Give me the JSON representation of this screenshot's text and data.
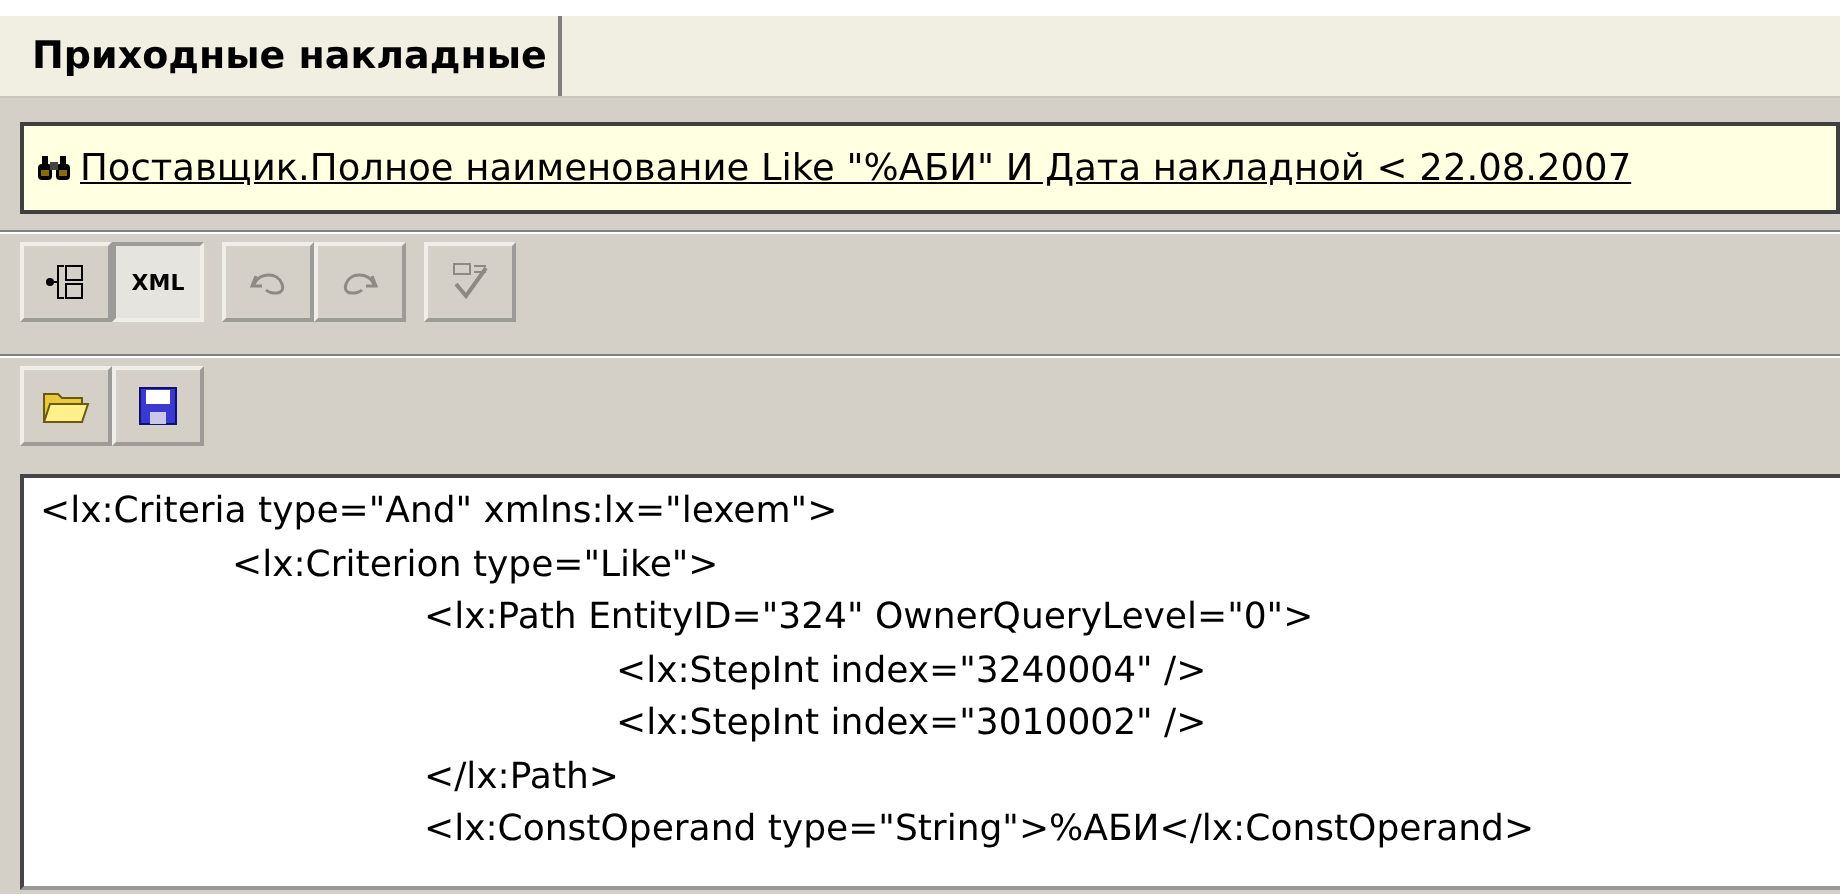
{
  "tabs": [
    {
      "label": "Приходные накладные",
      "selected": true
    }
  ],
  "filter": {
    "text": "Поставщик.Полное наименование Like \"%АБИ\" И  Дата накладной < 22.08.2007"
  },
  "toolbar": [
    {
      "kind": "tree",
      "selected": false,
      "disabled": false
    },
    {
      "kind": "xml",
      "label": "XML",
      "selected": true,
      "disabled": false
    },
    {
      "kind": "undo",
      "selected": false,
      "disabled": true
    },
    {
      "kind": "redo",
      "selected": false,
      "disabled": true
    },
    {
      "kind": "check",
      "selected": false,
      "disabled": true
    }
  ],
  "file_toolbar": [
    {
      "kind": "open"
    },
    {
      "kind": "save"
    }
  ],
  "xml_lines": [
    {
      "text": "<lx:Criteria type=\"And\" xmlns:lx=\"lexem\">",
      "children": [
        {
          "text": "<lx:Criterion type=\"Like\">",
          "children": [
            {
              "text": "<lx:Path EntityID=\"324\" OwnerQueryLevel=\"0\">",
              "children": [
                {
                  "text": "<lx:StepInt index=\"3240004\" />"
                },
                {
                  "text": "<lx:StepInt index=\"3010002\" />"
                }
              ]
            },
            {
              "text": "</lx:Path>"
            },
            {
              "text": "<lx:ConstOperand type=\"String\">%АБИ</lx:ConstOperand>"
            }
          ]
        }
      ]
    }
  ]
}
